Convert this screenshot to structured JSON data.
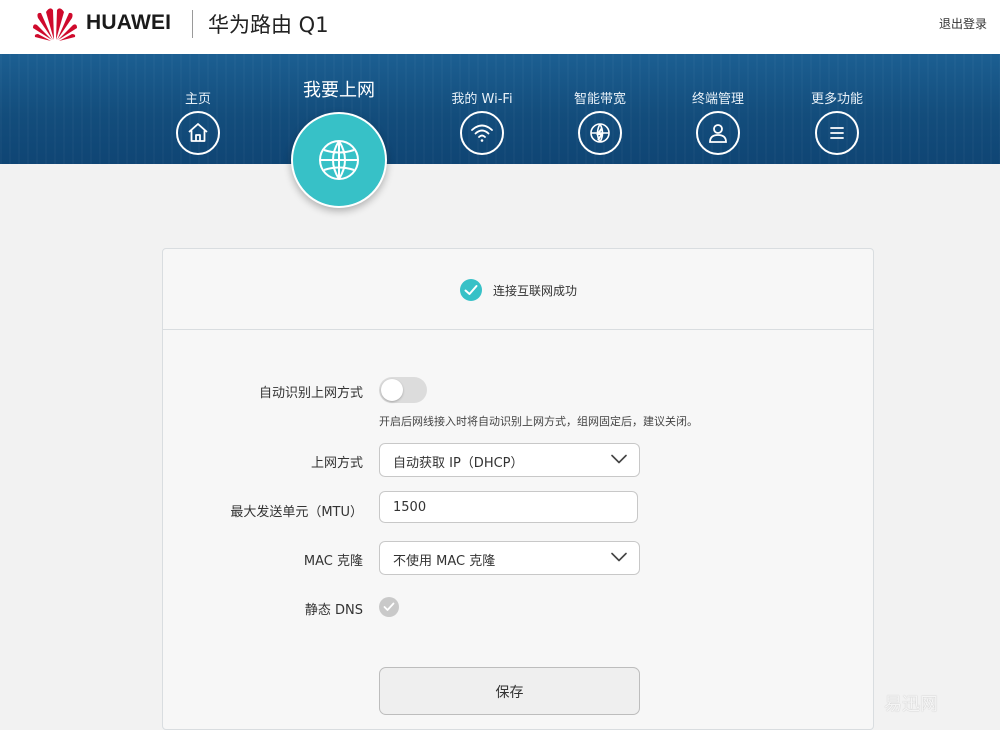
{
  "header": {
    "brand": "HUAWEI",
    "product": "华为路由 Q1",
    "logout": "退出登录",
    "brand_color": "#cf0a2c"
  },
  "nav": {
    "items": [
      {
        "label": "主页",
        "icon": "home-icon"
      },
      {
        "label": "我要上网",
        "icon": "globe-icon",
        "active": true
      },
      {
        "label": "我的 Wi-Fi",
        "icon": "wifi-icon"
      },
      {
        "label": "智能带宽",
        "icon": "bandwidth-icon"
      },
      {
        "label": "终端管理",
        "icon": "user-icon"
      },
      {
        "label": "更多功能",
        "icon": "menu-icon"
      }
    ],
    "active_color": "#37c1c7"
  },
  "status": {
    "text": "连接互联网成功",
    "icon": "check-icon"
  },
  "form": {
    "auto_detect": {
      "label": "自动识别上网方式",
      "enabled": false,
      "hint": "开启后网线接入时将自动识别上网方式，组网固定后，建议关闭。"
    },
    "wan_mode": {
      "label": "上网方式",
      "value": "自动获取 IP（DHCP）"
    },
    "mtu": {
      "label": "最大发送单元（MTU）",
      "value": "1500"
    },
    "mac_clone": {
      "label": "MAC 克隆",
      "value": "不使用 MAC 克隆"
    },
    "static_dns": {
      "label": "静态 DNS",
      "checked": false
    },
    "save_label": "保存"
  },
  "watermark": "易迅网"
}
